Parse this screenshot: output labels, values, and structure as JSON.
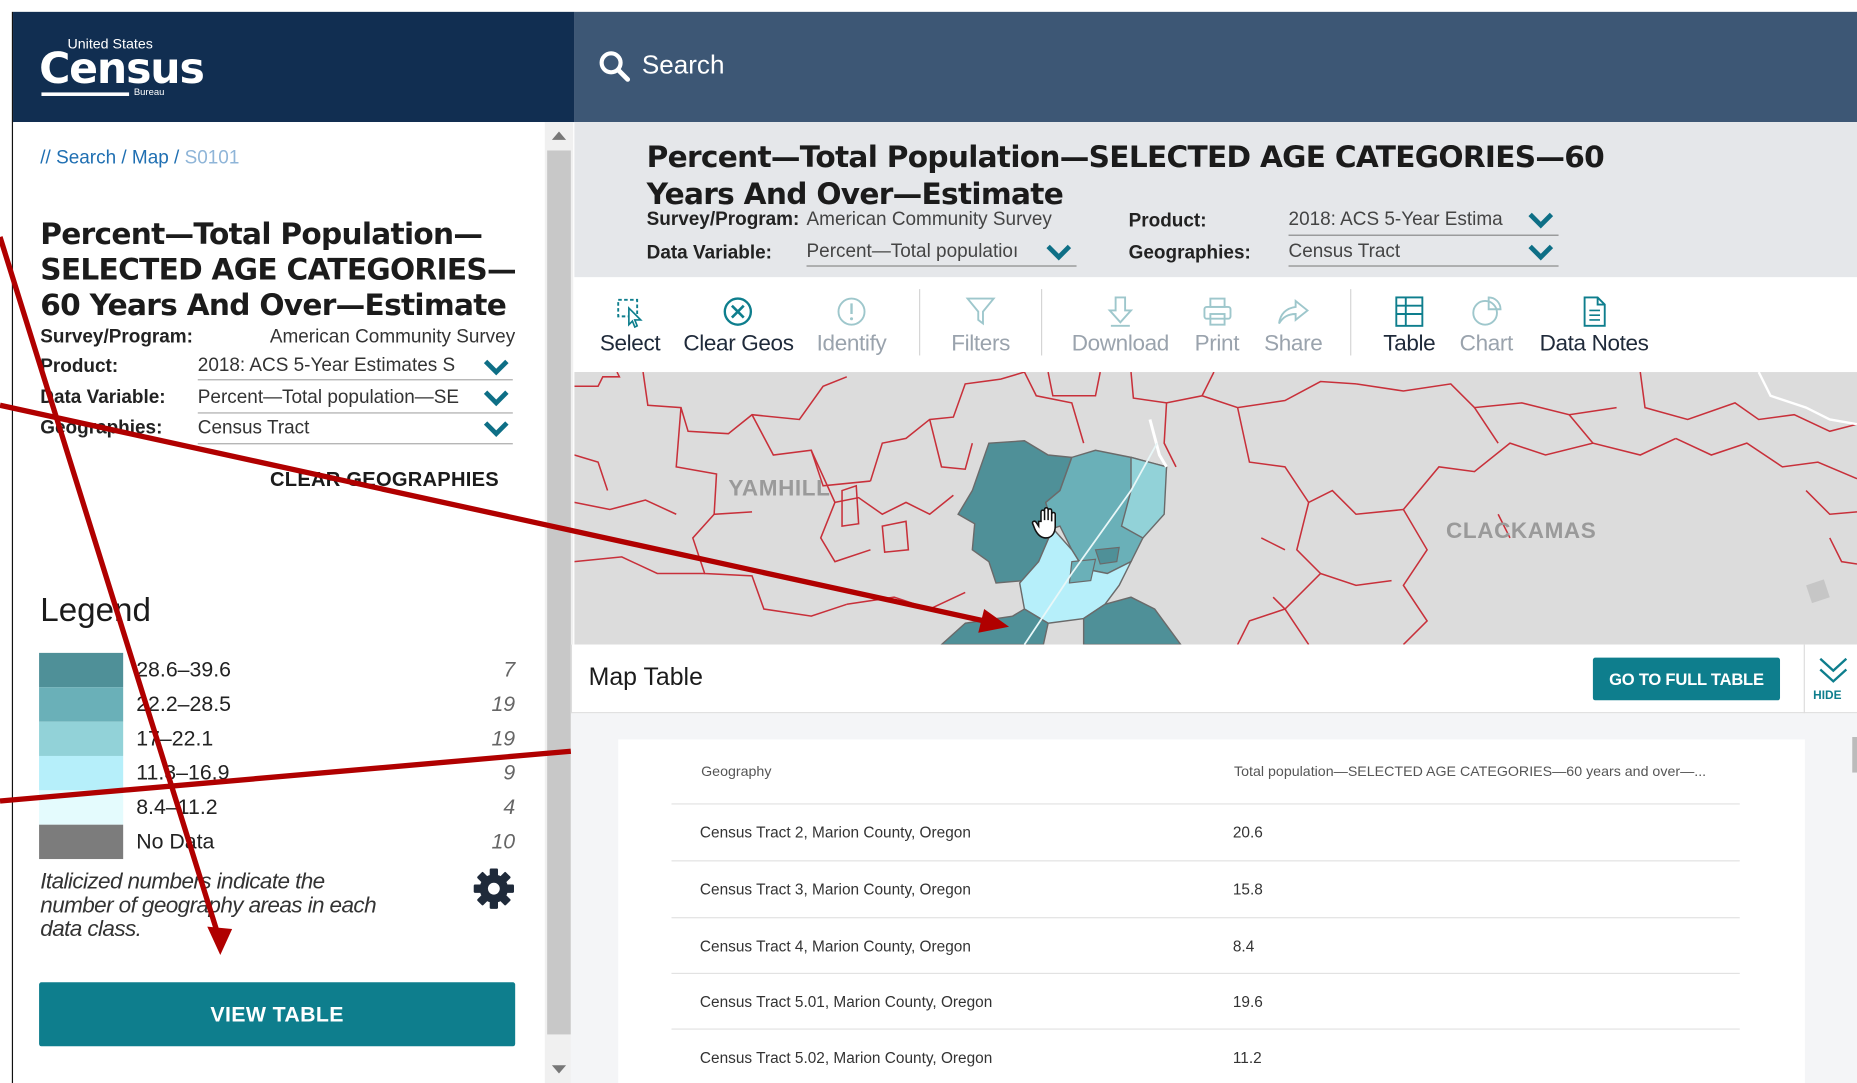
{
  "header": {
    "logo_top": "United States",
    "logo_main": "Census",
    "logo_bottom": "Bureau",
    "search_label": "Search"
  },
  "breadcrumb": {
    "prefix": "// ",
    "search": "Search",
    "sep": " / ",
    "map": "Map",
    "table_id": "S0101"
  },
  "sidebar": {
    "title": "Percent—Total Population—SELECTED AGE CATEGORIES—60 Years And Over—Estimate",
    "survey_label": "Survey/Program:",
    "survey_value": "American Community Survey",
    "product_label": "Product:",
    "product_value": "2018: ACS 5-Year Estimates S",
    "variable_label": "Data Variable:",
    "variable_value": "Percent—Total population—SE",
    "geo_label": "Geographies:",
    "geo_value": "Census Tract",
    "clear_geographies": "CLEAR GEOGRAPHIES",
    "legend_title": "Legend",
    "legend": [
      {
        "label": "28.6–39.6",
        "count": "7",
        "color": "#4f9098"
      },
      {
        "label": "22.2–28.5",
        "count": "19",
        "color": "#6ab0b8"
      },
      {
        "label": "17–22.1",
        "count": "19",
        "color": "#92d2d8"
      },
      {
        "label": "11.3–16.9",
        "count": "9",
        "color": "#b6effa"
      },
      {
        "label": "8.4–11.2",
        "count": "4",
        "color": "#e4fbfd"
      },
      {
        "label": "No Data",
        "count": "10",
        "color": "#7c7c7c"
      }
    ],
    "legend_note": "Italicized numbers indicate the number of geography areas in each data class.",
    "view_table": "VIEW TABLE"
  },
  "info": {
    "title": "Percent—Total Population—SELECTED AGE CATEGORIES—60 Years And Over—Estimate",
    "survey_label": "Survey/Program:",
    "survey_value": "American Community Survey",
    "product_label": "Product:",
    "product_value": "2018: ACS 5-Year Estima",
    "variable_label": "Data Variable:",
    "variable_value": "Percent—Total populatioı",
    "geo_label": "Geographies:",
    "geo_value": "Census Tract"
  },
  "toolbar": {
    "select": "Select",
    "clear_geos": "Clear Geos",
    "identify": "Identify",
    "filters": "Filters",
    "download": "Download",
    "print": "Print",
    "share": "Share",
    "table": "Table",
    "chart": "Chart",
    "data_notes": "Data Notes"
  },
  "map": {
    "label_yamhill": "YAMHILL",
    "label_clackamas": "CLACKAMAS"
  },
  "map_table": {
    "title": "Map Table",
    "full_table": "GO TO FULL TABLE",
    "hide": "HIDE",
    "columns": [
      "Geography",
      "Total population—SELECTED AGE CATEGORIES—60 years and over—..."
    ],
    "rows": [
      [
        "Census Tract 2, Marion County, Oregon",
        "20.6"
      ],
      [
        "Census Tract 3, Marion County, Oregon",
        "15.8"
      ],
      [
        "Census Tract 4, Marion County, Oregon",
        "8.4"
      ],
      [
        "Census Tract 5.01, Marion County, Oregon",
        "19.6"
      ],
      [
        "Census Tract 5.02, Marion County, Oregon",
        "11.2"
      ]
    ]
  },
  "colors": {
    "brand_navy": "#112e51",
    "search_bar": "#3d5775",
    "accent_teal": "#0e7e8d",
    "link_blue": "#1f6fb2",
    "annotation_red": "#b00000",
    "boundary_red": "#c8303a"
  }
}
